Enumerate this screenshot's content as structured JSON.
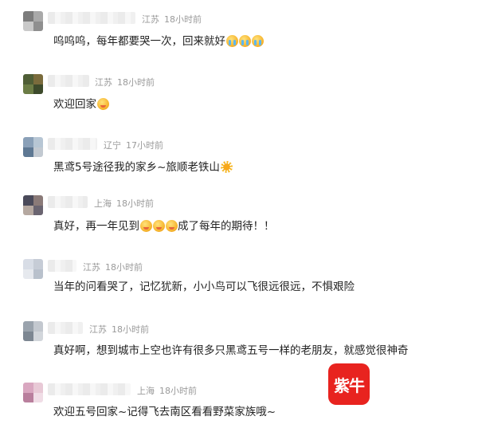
{
  "comments": [
    {
      "location": "江苏",
      "time": "18小时前",
      "text": "呜呜呜，每年都要哭一次，回来就好",
      "emojis": [
        "crying-face-icon",
        "crying-face-icon",
        "crying-face-icon"
      ],
      "avatar_colors": [
        "#7c7c7c",
        "#a9a9a9",
        "#c9c9c9",
        "#8f8f8f"
      ]
    },
    {
      "location": "江苏",
      "time": "18小时前",
      "text": "欢迎回家",
      "emojis": [
        "blush-face-icon"
      ],
      "avatar_colors": [
        "#4f5e36",
        "#7a6b3c",
        "#6b7c45",
        "#3d4a2b"
      ]
    },
    {
      "location": "辽宁",
      "time": "17小时前",
      "text": "黑鸢5号途径我的家乡~旅顺老铁山",
      "emojis": [
        "sun-icon"
      ],
      "avatar_colors": [
        "#8aa0b8",
        "#b7c6d4",
        "#5e7893",
        "#c2c9d1"
      ]
    },
    {
      "location": "上海",
      "time": "18小时前",
      "text_before": "真好，再一年见到",
      "emojis": [
        "blush-face-icon",
        "blush-face-icon",
        "blush-face-icon"
      ],
      "text_after": "成了每年的期待！！",
      "avatar_colors": [
        "#4a4a5a",
        "#8a7a78",
        "#b5a8a0",
        "#6a6470"
      ]
    },
    {
      "location": "江苏",
      "time": "18小时前",
      "text": "当年的问看哭了，记忆犹新，小小鸟可以飞很远很远，不惧艰险",
      "emojis": [],
      "avatar_colors": [
        "#d8dde6",
        "#c6ccd6",
        "#e6e9ee",
        "#b9c1cc"
      ]
    },
    {
      "location": "江苏",
      "time": "18小时前",
      "text": "真好啊，想到城市上空也许有很多只黑鸢五号一样的老朋友，就感觉很神奇",
      "emojis": [],
      "avatar_colors": [
        "#9aa3ad",
        "#c3c8cf",
        "#7d8792",
        "#d2d6db"
      ]
    },
    {
      "location": "上海",
      "time": "18小时前",
      "text": "欢迎五号回家~记得飞去南区看看野菜家族哦~",
      "emojis": [],
      "avatar_colors": [
        "#d9a7c0",
        "#e8c9d6",
        "#b97f9d",
        "#f0dde6"
      ]
    }
  ],
  "watermark_logo": {
    "text": "紫牛",
    "color": "#e8231f"
  }
}
